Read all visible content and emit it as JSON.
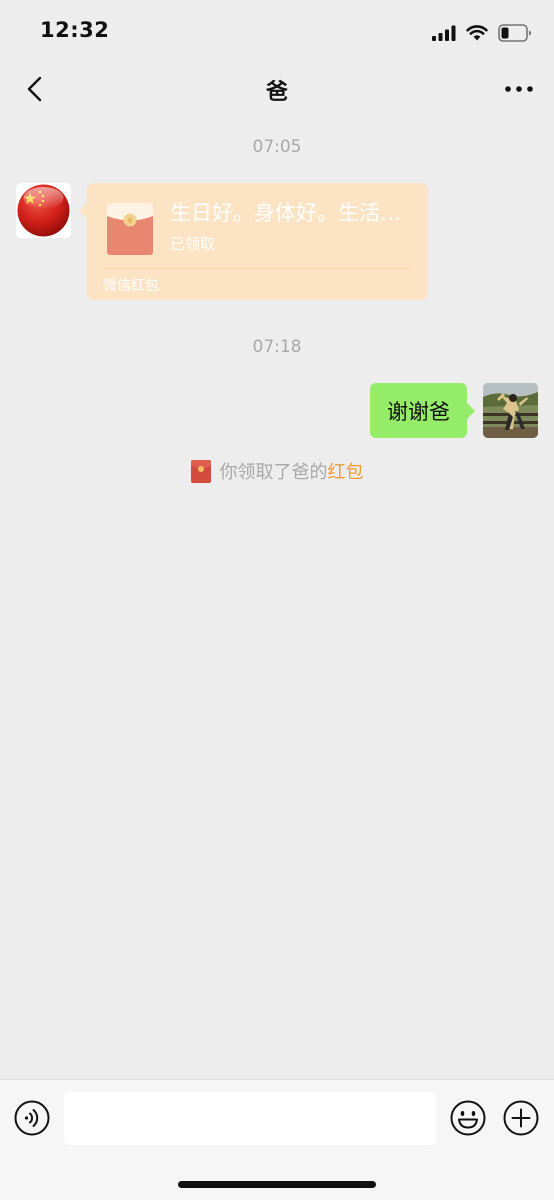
{
  "status_bar": {
    "time": "12:32",
    "icons": [
      "cellular-signal-icon",
      "wifi-icon",
      "battery-icon"
    ]
  },
  "header": {
    "title": "爸",
    "back_icon": "chevron-left-icon",
    "more_icon": "more-dots-icon"
  },
  "messages": {
    "time_1": "07:05",
    "red_packet": {
      "greeting": "生日好。身体好。生活好。",
      "status": "已领取",
      "footer": "微信红包",
      "color": "#fbe3c3"
    },
    "time_2": "07:18",
    "my_message": {
      "text": "谢谢爸",
      "bubble_color": "#95ec69"
    },
    "system_note": {
      "text": "你领取了爸的",
      "link": "红包",
      "link_color": "#f09b35"
    }
  },
  "input_bar": {
    "voice_icon": "voice-icon",
    "emoji_icon": "emoji-icon",
    "plus_icon": "plus-icon",
    "input_value": ""
  }
}
